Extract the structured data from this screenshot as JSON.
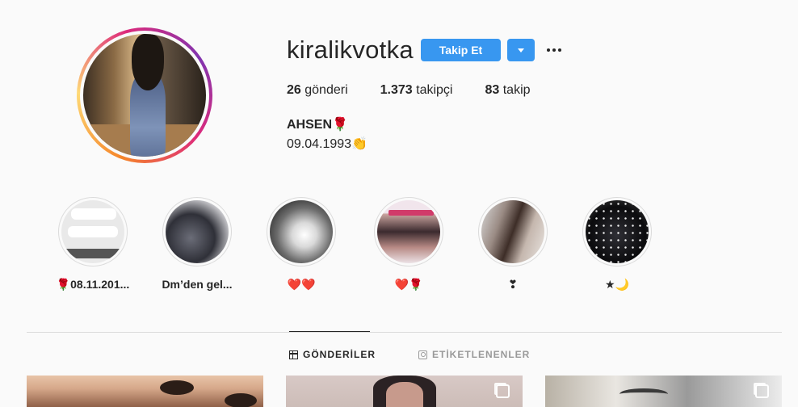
{
  "profile": {
    "username": "kiralikvotka",
    "follow_label": "Takip Et",
    "full_name": "AHSEN🌹",
    "bio": "09.04.1993👏"
  },
  "stats": {
    "posts_count": "26",
    "posts_label": "gönderi",
    "followers_count": "1.373",
    "followers_label": "takipçi",
    "following_count": "83",
    "following_label": "takip"
  },
  "highlights": [
    {
      "label": "🌹08.11.201..."
    },
    {
      "label": "Dm’den gel..."
    },
    {
      "label": "❤️❤️"
    },
    {
      "label": "❤️🌹"
    },
    {
      "label": "❣"
    },
    {
      "label": "★🌙"
    }
  ],
  "tabs": {
    "posts_label": "GÖNDERİLER",
    "tagged_label": "ETİKETLENENLER"
  },
  "icons": {
    "more": "more-options-icon",
    "dropdown": "chevron-down-icon",
    "grid": "grid-icon",
    "tagged": "tagged-icon",
    "multiple_posts": "carousel-icon"
  },
  "colors": {
    "primary_button": "#3897f0",
    "background": "#fafafa",
    "text": "#262626",
    "muted_text": "#999999"
  }
}
